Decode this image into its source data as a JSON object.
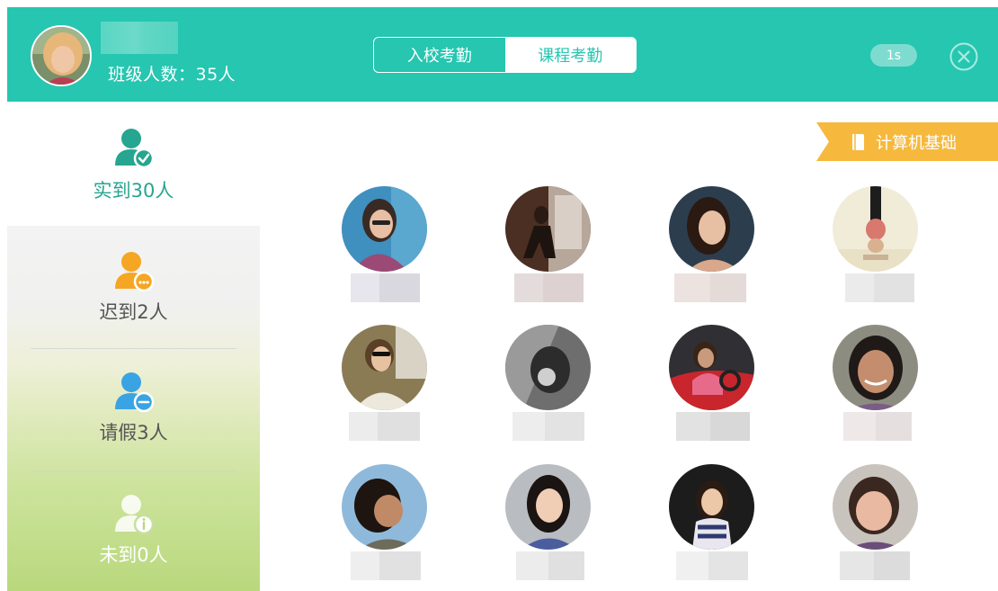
{
  "header": {
    "class_count": "班级人数：35人",
    "tabs": [
      {
        "label": "入校考勤",
        "active": false
      },
      {
        "label": "课程考勤",
        "active": true
      }
    ],
    "timer": "1s",
    "close_icon": "close-circle-icon"
  },
  "stats": {
    "present": {
      "label": "实到30人",
      "color": "#26a590",
      "icon": "user-check-icon"
    },
    "late": {
      "label": "迟到2人",
      "color": "#f5a623",
      "icon": "user-more-icon"
    },
    "leave": {
      "label": "请假3人",
      "color": "#3aa3e3",
      "icon": "user-minus-icon"
    },
    "absent": {
      "label": "未到0人",
      "color": "#ffffff",
      "icon": "user-info-icon"
    }
  },
  "course": {
    "label": "计算机基础",
    "icon": "book-icon"
  },
  "colors": {
    "accent": "#26c6b0",
    "present": "#26a590",
    "late": "#f5a623",
    "leave": "#3aa3e3",
    "badge": "#f6b93d"
  },
  "students_count": 12
}
